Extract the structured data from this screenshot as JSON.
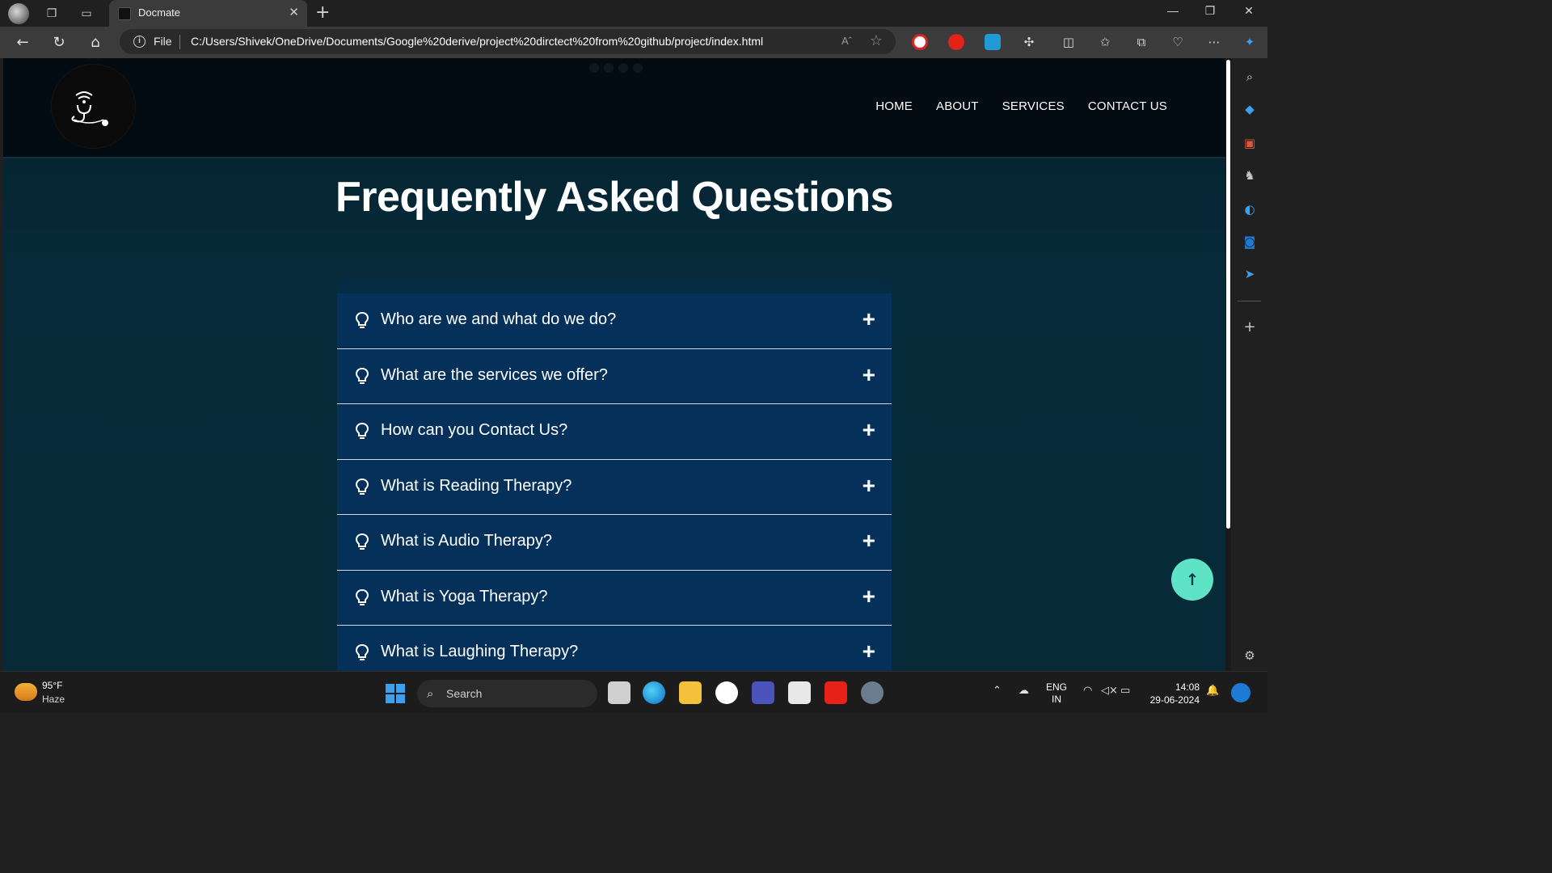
{
  "browser": {
    "tab_title": "Docmate",
    "file_label": "File",
    "url": "C:/Users/Shivek/OneDrive/Documents/Google%20derive/project%20dirctect%20from%20github/project/index.html",
    "read_aloud": "Aˆ",
    "window_controls": {
      "minimize": "—",
      "restore": "❐",
      "close": "✕"
    }
  },
  "site": {
    "nav": [
      "HOME",
      "ABOUT",
      "SERVICES",
      "CONTACT US"
    ],
    "faq_title": "Frequently Asked Questions",
    "faq_questions": [
      "Who are we and what do we do?",
      "What are the services we offer?",
      "How can you Contact Us?",
      "What is Reading Therapy?",
      "What is Audio Therapy?",
      "What is Yoga Therapy?",
      "What is Laughing Therapy?"
    ],
    "back_to_top_icon": "↑",
    "colors": {
      "accent": "#5fe3c7",
      "faq_item_bg": "#04305a",
      "page_bg": "#062c3b"
    }
  },
  "taskbar": {
    "weather_temp": "95°F",
    "weather_desc": "Haze",
    "search_label": "Search",
    "lang_line1": "ENG",
    "lang_line2": "IN",
    "time": "14:08",
    "date": "29-06-2024"
  }
}
